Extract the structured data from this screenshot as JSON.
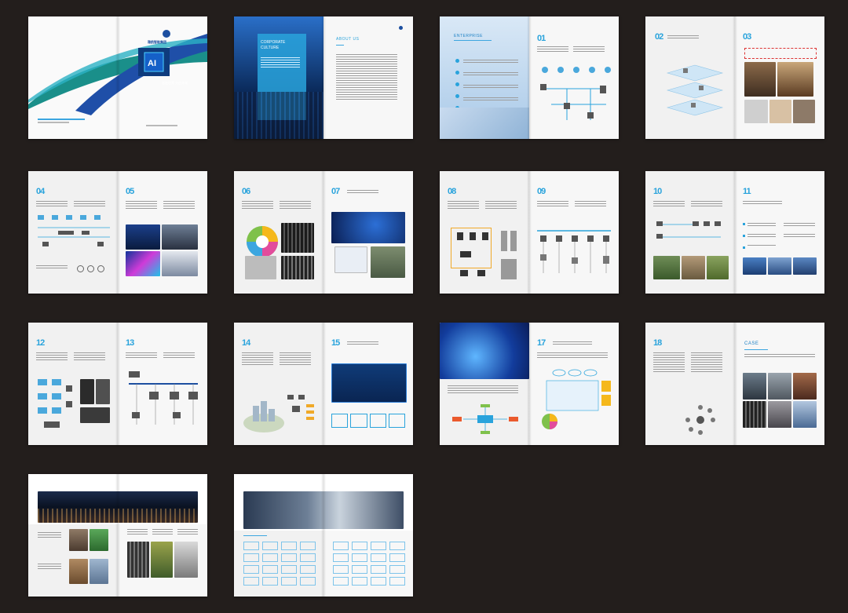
{
  "canvas": {
    "background": "#231e1c"
  },
  "accent": {
    "blue": "#29a3dc",
    "navy": "#1d4fa0",
    "teal": "#1a8f8a"
  },
  "cover": {
    "company_name": "雅航智能集团",
    "slogan": "智能世界 共创未来",
    "badge_text": "AI"
  },
  "spreads": [
    {
      "id": "cover"
    },
    {
      "id": "culture",
      "left_title": "CORPORATE\nCULTURE",
      "right_title": "ABOUT US"
    },
    {
      "id": "enterprise",
      "left_title": "ENTERPRISE",
      "right_num": "01"
    },
    {
      "id": "s02",
      "left_num": "02",
      "right_num": "03"
    },
    {
      "id": "s04",
      "left_num": "04",
      "right_num": "05"
    },
    {
      "id": "s06",
      "left_num": "06",
      "right_num": "07"
    },
    {
      "id": "s08",
      "left_num": "08",
      "right_num": "09"
    },
    {
      "id": "s10",
      "left_num": "10",
      "right_num": "11"
    },
    {
      "id": "s12",
      "left_num": "12",
      "right_num": "13"
    },
    {
      "id": "s14",
      "left_num": "14",
      "right_num": "15"
    },
    {
      "id": "s16",
      "right_num": "17"
    },
    {
      "id": "s18",
      "left_num": "18",
      "right_title": "CASE"
    },
    {
      "id": "s20"
    },
    {
      "id": "partners"
    }
  ]
}
